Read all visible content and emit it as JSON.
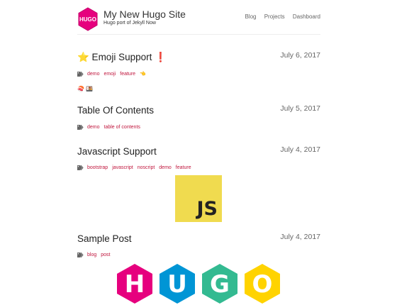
{
  "header": {
    "logo_text": "HUGO",
    "title": "My New Hugo Site",
    "subtitle": "Hugo port of Jekyll Now",
    "nav": [
      "Blog",
      "Projects",
      "Dashboard"
    ]
  },
  "posts": [
    {
      "title": "⭐ Emoji Support ❗",
      "date": "July 6, 2017",
      "tags": [
        "demo",
        "emoji",
        "feature",
        "👈"
      ],
      "extra_line": "🍣 🍱"
    },
    {
      "title": "Table Of Contents",
      "date": "July 5, 2017",
      "tags": [
        "demo",
        "table of contents"
      ]
    },
    {
      "title": "Javascript Support",
      "date": "July 4, 2017",
      "tags": [
        "bootstrap",
        "javascript",
        "noscript",
        "demo",
        "feature"
      ],
      "image_text": "JS"
    },
    {
      "title": "Sample Post",
      "date": "July 4, 2017",
      "tags": [
        "blog",
        "post"
      ],
      "image_text": [
        "H",
        "U",
        "G",
        "O"
      ]
    }
  ],
  "colors": {
    "tag": "#c0163d",
    "hugo_logo": "#e6007e",
    "js_yellow": "#f0db4f"
  }
}
